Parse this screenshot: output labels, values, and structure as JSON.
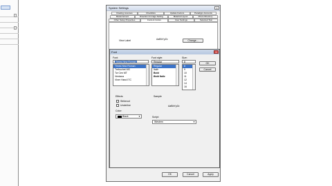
{
  "background_window": {},
  "system_settings": {
    "title": "System Settings",
    "close": "×",
    "tabs_row1": [
      "Floating Licenses",
      "Checklists",
      "Update Factors",
      "Paradigm Accounts"
    ],
    "tabs_row2": [
      "Measurement",
      "Direction & Image Setting",
      "Material Layout",
      "Photo Directory"
    ],
    "tabs_row3": [
      "Other Setup Properties",
      "Fonts & Colors",
      "User Settings",
      "Selected Test"
    ],
    "view_label_caption": "View Label",
    "sample_text": "AaBbYyZz",
    "change_button": "Change...",
    "ok_button": "OK",
    "cancel_button": "Cancel",
    "apply_button": "Apply"
  },
  "font_dialog": {
    "title": "Font",
    "close": "×",
    "font_label": "Font:",
    "font_value": "Times New Roman",
    "font_list": [
      "Times New Roman",
      "Trebuchet MS",
      "Tw Cen MT",
      "Verdana",
      "Viner Hand ITC"
    ],
    "font_selected_index": 0,
    "style_label": "Font style:",
    "style_value": "Regular",
    "style_list": [
      "Regular",
      "Italic",
      "Bold",
      "Bold Italic"
    ],
    "style_selected_index": 0,
    "size_label": "Size:",
    "size_value": "8",
    "size_list": [
      "8",
      "9",
      "10",
      "11",
      "12",
      "14",
      "16"
    ],
    "size_selected_index": 0,
    "ok_button": "OK",
    "cancel_button": "Cancel",
    "effects_label": "Effects",
    "strikeout_label": "Strikeout",
    "underline_label": "Underline",
    "color_label": "Color:",
    "color_value": "Black",
    "sample_label": "Sample",
    "sample_text": "AaBbYyZz",
    "script_label": "Script:",
    "script_value": "Western"
  }
}
